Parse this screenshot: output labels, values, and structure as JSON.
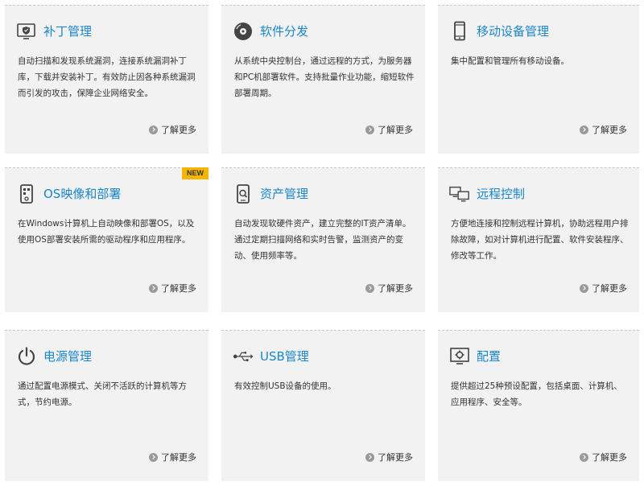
{
  "cards": [
    {
      "title": "补丁管理",
      "icon": "patch-shield-monitor-icon",
      "desc": "自动扫描和发现系统漏洞，连接系统漏洞补丁库，下载并安装补丁。有效防止因各种系统漏洞而引发的攻击，保障企业网络安全。",
      "more": "了解更多"
    },
    {
      "title": "软件分发",
      "icon": "software-disc-icon",
      "desc": "从系统中央控制台，通过远程的方式，为服务器和PC机部署软件。支持批量作业功能，缩短软件部署周期。",
      "more": "了解更多"
    },
    {
      "title": "移动设备管理",
      "icon": "mobile-device-icon",
      "desc": "集中配置和管理所有移动设备。",
      "more": "了解更多"
    },
    {
      "title": "OS映像和部署",
      "icon": "os-imaging-icon",
      "desc": "在Windows计算机上自动映像和部署OS，以及使用OS部署安装所需的驱动程序和应用程序。",
      "more": "了解更多",
      "badge": "NEW"
    },
    {
      "title": "资产管理",
      "icon": "asset-search-device-icon",
      "desc": "自动发现软硬件资产，建立完整的IT资产清单。通过定期扫描网络和实时告警，监测资产的变动、使用频率等。",
      "more": "了解更多"
    },
    {
      "title": "远程控制",
      "icon": "remote-monitors-icon",
      "desc": "方便地连接和控制远程计算机，协助远程用户排除故障，如对计算机进行配置、软件安装程序、修改等工作。",
      "more": "了解更多"
    },
    {
      "title": "电源管理",
      "icon": "power-icon",
      "desc": "通过配置电源模式、关闭不活跃的计算机等方式，节约电源。",
      "more": "了解更多"
    },
    {
      "title": "USB管理",
      "icon": "usb-icon",
      "desc": "有效控制USB设备的使用。",
      "more": "了解更多"
    },
    {
      "title": "配置",
      "icon": "config-gear-monitor-icon",
      "desc": "提供超过25种预设配置，包括桌面、计算机、应用程序、安全等。",
      "more": "了解更多"
    }
  ],
  "colors": {
    "accent": "#1a87c9",
    "card_bg": "#f2f2f2",
    "badge_bg": "#f7b500"
  }
}
